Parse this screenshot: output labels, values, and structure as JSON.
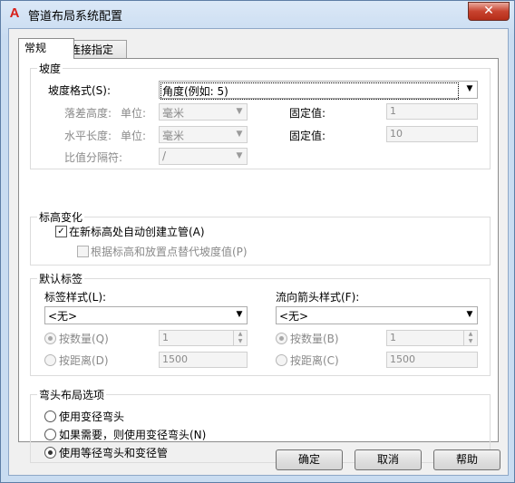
{
  "window": {
    "title": "管道布局系统配置",
    "close_label": "✕"
  },
  "tabs": [
    {
      "label": "常规"
    },
    {
      "label": "连接指定"
    }
  ],
  "slope": {
    "group_title": "坡度",
    "format_label": "坡度格式(S):",
    "format_value": "角度(例如: 5)",
    "rise_label": "落差高度:",
    "run_label": "水平长度:",
    "sep_label": "比值分隔符:",
    "unit_label": "单位:",
    "unit_value": "毫米",
    "fixed_label": "固定值:",
    "rise_fixed": "1",
    "run_fixed": "10",
    "sep_value": "/"
  },
  "elevation": {
    "group_title": "标高变化",
    "auto_riser_label": "在新标高处自动创建立管(A)",
    "auto_riser_checked": "✓",
    "replace_slope_label": "根据标高和放置点替代坡度值(P)"
  },
  "labels": {
    "group_title": "默认标签",
    "label_style_label": "标签样式(L):",
    "label_style_value": "<无>",
    "arrow_style_label": "流向箭头样式(F):",
    "arrow_style_value": "<无>",
    "by_count_q": "按数量(Q)",
    "by_distance_d": "按距离(D)",
    "by_count_b": "按数量(B)",
    "by_distance_c": "按距离(C)",
    "count_value_1": "1",
    "distance_value_1": "1500",
    "count_value_2": "1",
    "distance_value_2": "1500"
  },
  "elbow": {
    "group_title": "弯头布局选项",
    "option1": "使用变径弯头",
    "option2": "如果需要，则使用变径弯头(N)",
    "option3": "使用等径弯头和变径管"
  },
  "buttons": {
    "ok": "确定",
    "cancel": "取消",
    "help": "帮助"
  }
}
